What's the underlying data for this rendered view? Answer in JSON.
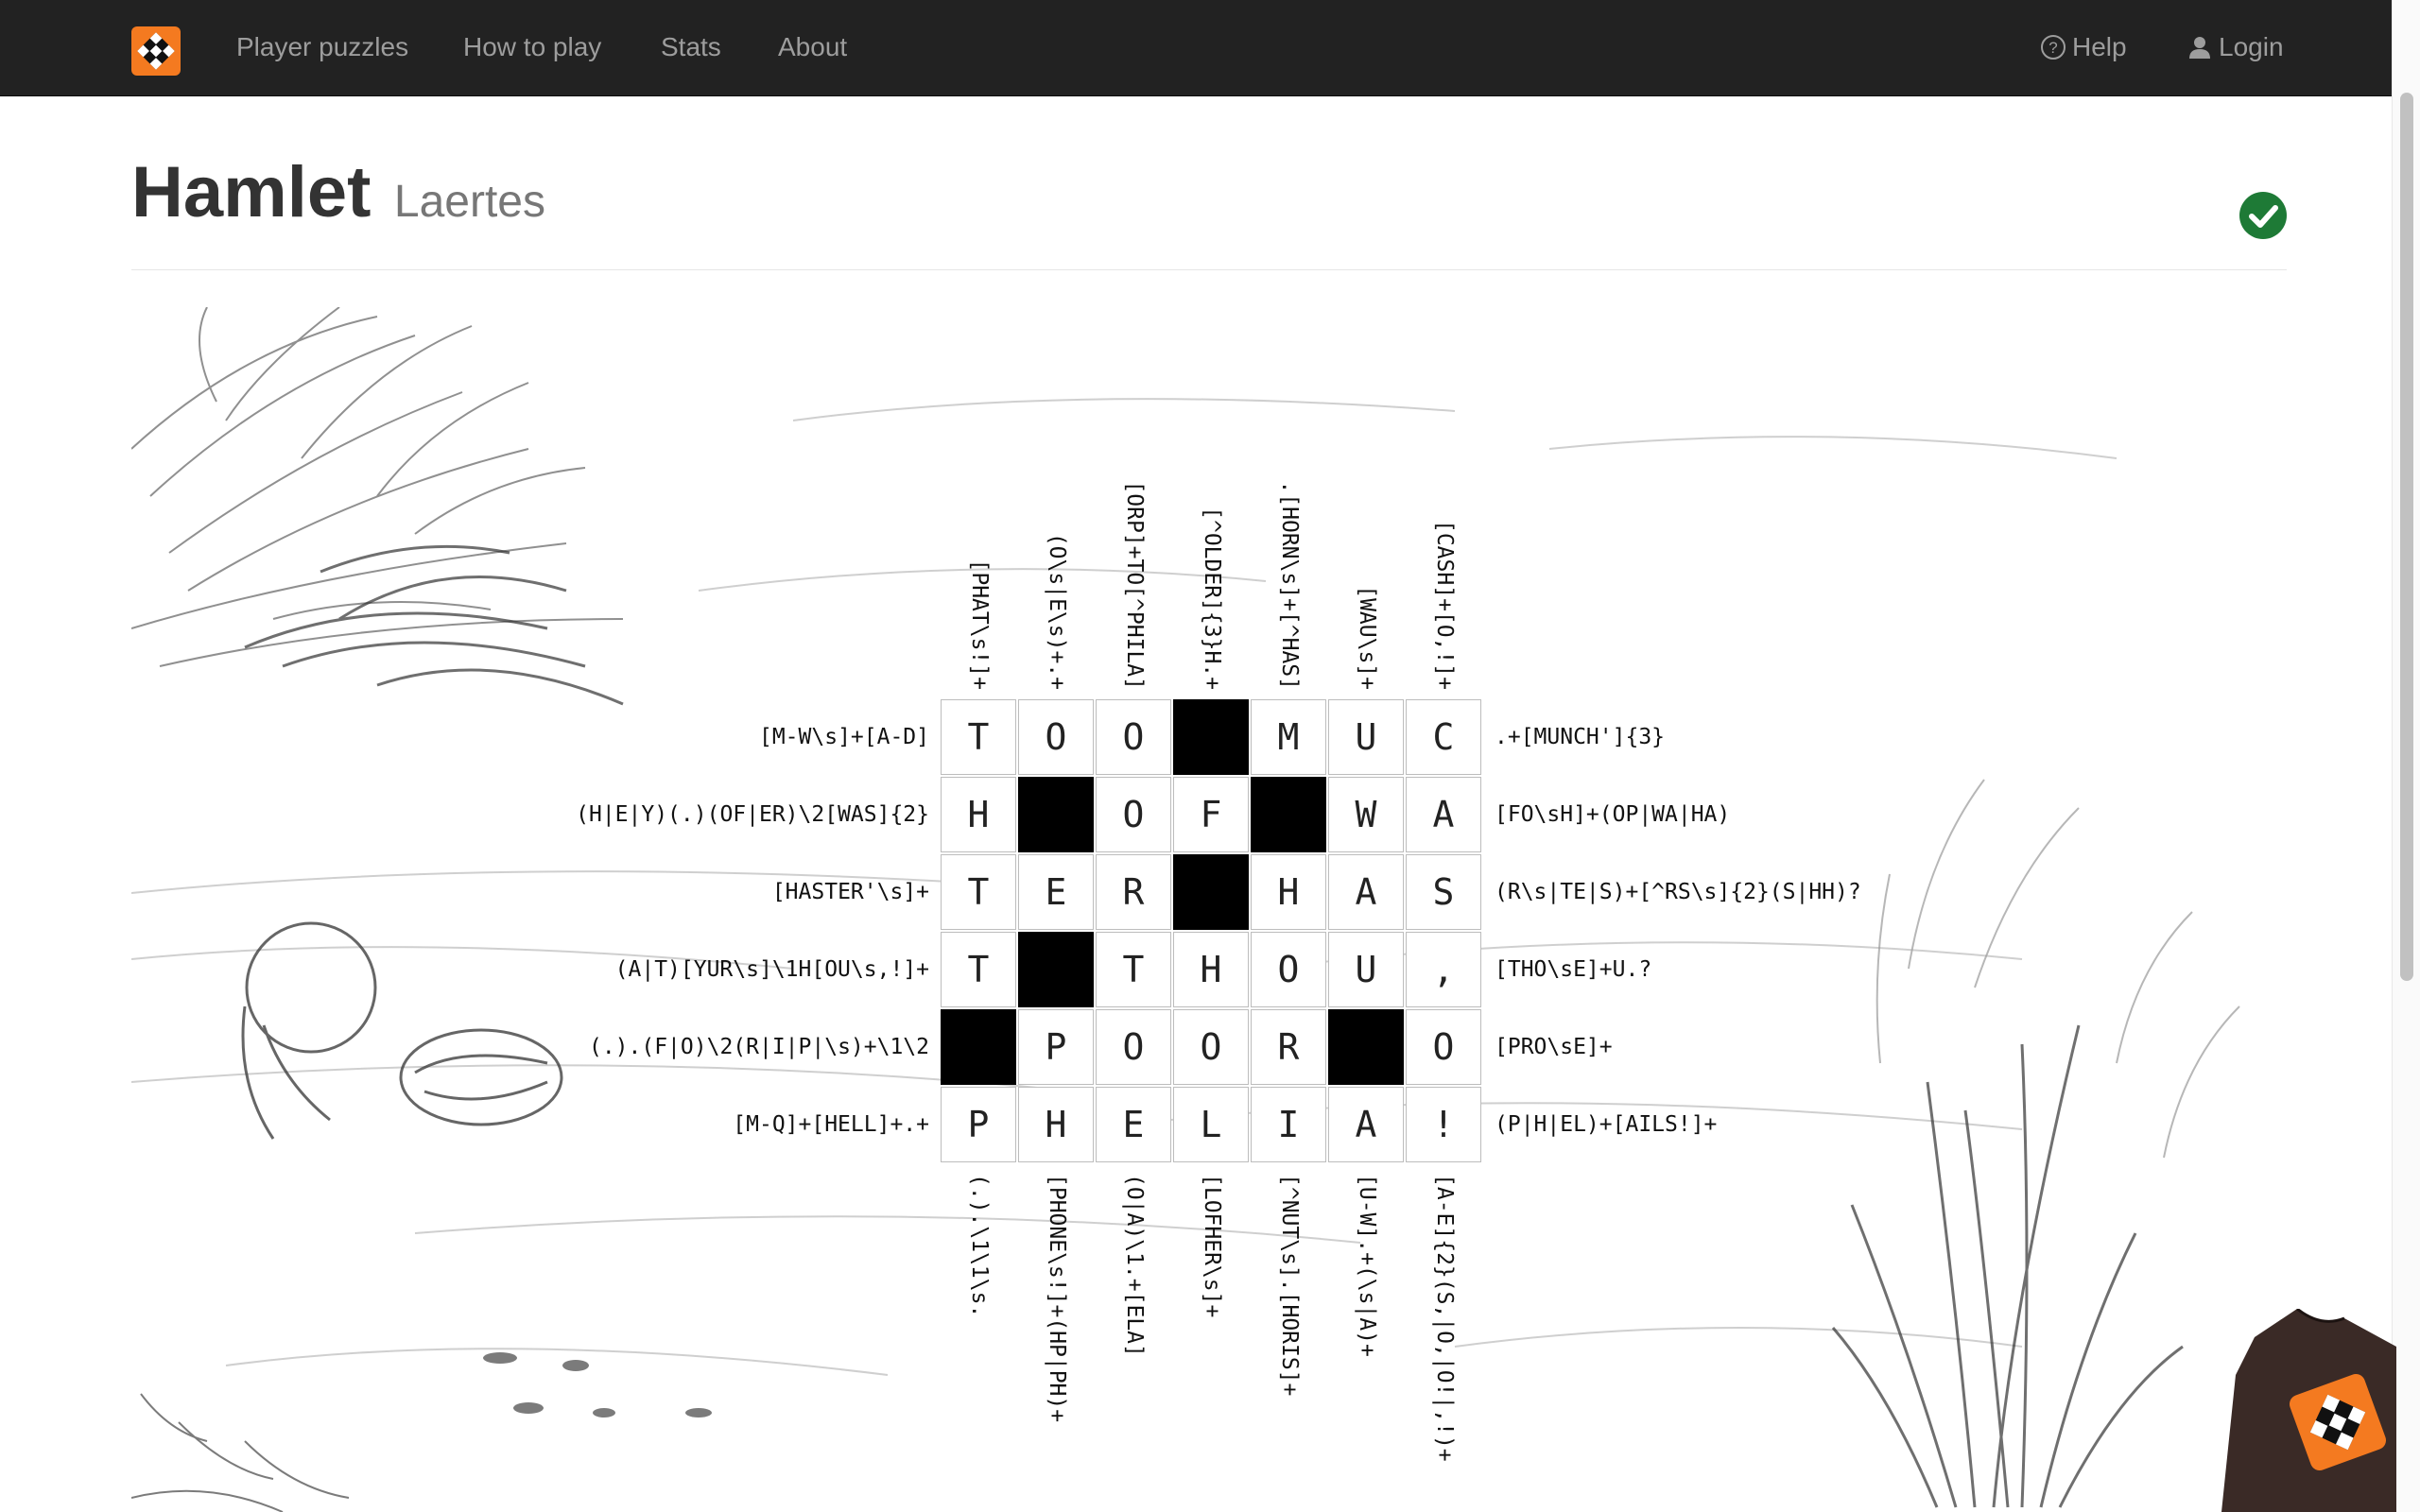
{
  "nav": {
    "links": [
      "Player puzzles",
      "How to play",
      "Stats",
      "About"
    ],
    "help": "Help",
    "login": "Login"
  },
  "header": {
    "title": "Hamlet",
    "subtitle": "Laertes"
  },
  "colors": {
    "navbar": "#222222",
    "brand_orange": "#f47a20",
    "solved_green": "#1e7a36"
  },
  "icons": [
    "logo-icon",
    "help-icon",
    "user-icon",
    "checkmark-icon",
    "shirt-icon"
  ],
  "puzzle": {
    "grid": [
      [
        "T",
        "O",
        "O",
        "#",
        "M",
        "U",
        "C"
      ],
      [
        "H",
        "#",
        "O",
        "F",
        "#",
        "W",
        "A"
      ],
      [
        "T",
        "E",
        "R",
        "#",
        "H",
        "A",
        "S"
      ],
      [
        "T",
        "#",
        "T",
        "H",
        "O",
        "U",
        ","
      ],
      [
        "#",
        "P",
        "O",
        "O",
        "R",
        "#",
        "O"
      ],
      [
        "P",
        "H",
        "E",
        "L",
        "I",
        "A",
        "!"
      ]
    ],
    "top_clues": [
      "[PHAT\\s!]+",
      "(O\\s|E\\s)+.+",
      "[ORP]+TO[^PHILA]",
      "[^OLDER]{3}H.+",
      ".[HORN\\s]+[^HAS]",
      "[WAU\\s]+",
      "[CASH]+[O,!]+"
    ],
    "bottom_clues": [
      "(.).\\1\\1\\s.",
      "[PHONE\\s!]+(HP|PH)+",
      "(O|A)\\1.+[ELA]",
      "[LOFHER\\s]+",
      "[^NUT\\s].[HORIS]+",
      "[U-W].+(\\s|A)+",
      "[A-E]{2}(S,|O,|O!|,!)+"
    ],
    "left_clues": [
      "[M-W\\s]+[A-D]",
      "(H|E|Y)(.)(OF|ER)\\2[WAS]{2}",
      "[HASTER'\\s]+",
      "(A|T)[YUR\\s]\\1H[OU\\s,!]+",
      "(.).(F|O)\\2(R|I|P|\\s)+\\1\\2",
      "[M-Q]+[HELL]+.+"
    ],
    "right_clues": [
      ".+[MUNCH']{3}",
      "[FO\\sH]+(OP|WA|HA)",
      "(R\\s|TE|S)+[^RS\\s]{2}(S|HH)?",
      "[THO\\sE]+U.?",
      "[PRO\\sE]+",
      "(P|H|EL)+[AILS!]+"
    ]
  }
}
